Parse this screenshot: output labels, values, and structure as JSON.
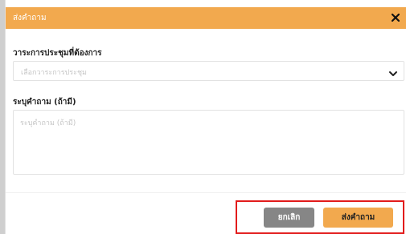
{
  "modal": {
    "title": "ส่งคำถาม",
    "close_icon": "close-icon",
    "accent_color": "#f2a94e"
  },
  "form": {
    "agenda_label": "วาระการประชุมที่ต้องการ",
    "agenda_placeholder": "เลือกวาระการประชุม",
    "question_label": "ระบุคำถาม (ถ้ามี)",
    "question_placeholder": "ระบุคำถาม (ถ้ามี)"
  },
  "footer": {
    "cancel_label": "ยกเลิก",
    "submit_label": "ส่งคำถาม"
  }
}
